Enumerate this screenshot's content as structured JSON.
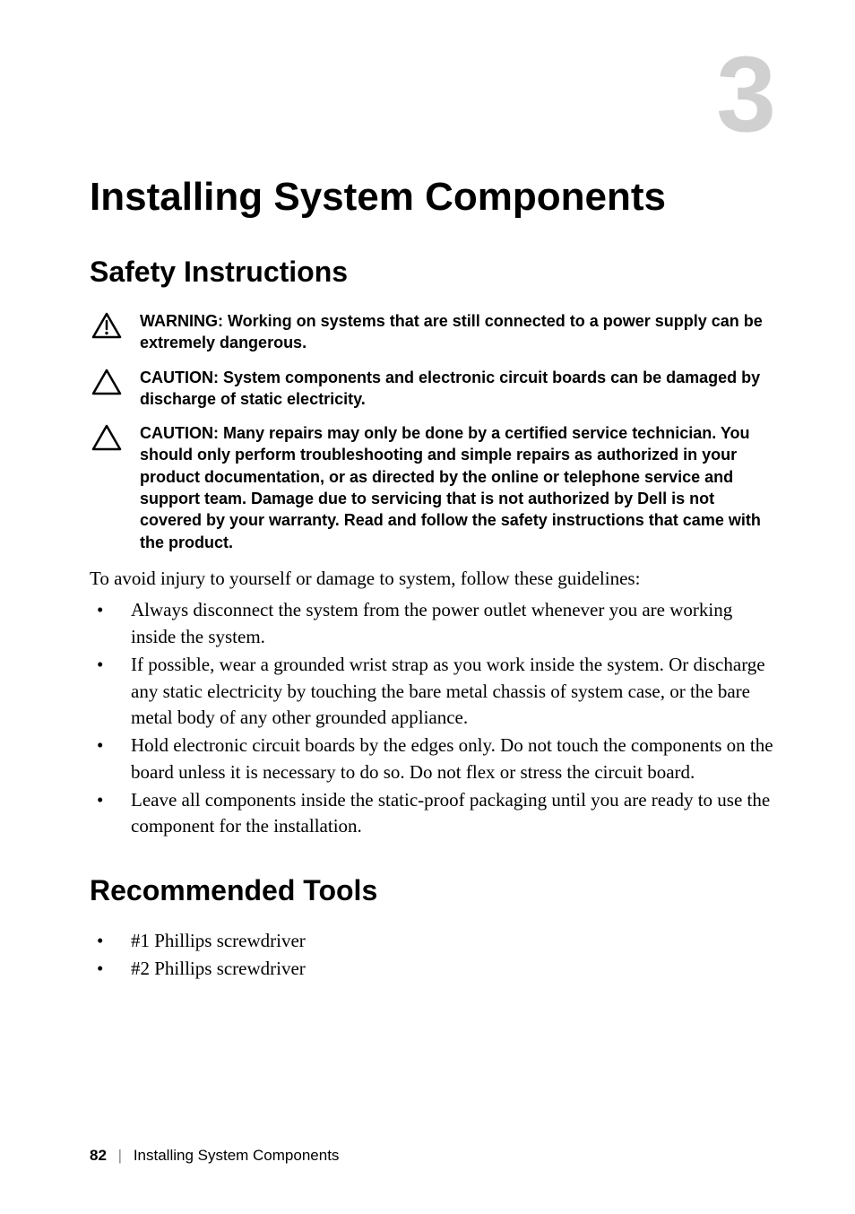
{
  "chapter": {
    "number": "3",
    "title": "Installing System Components"
  },
  "sections": {
    "safety": {
      "title": "Safety Instructions",
      "warning": {
        "label": "WARNING: ",
        "text": "Working on systems that are still connected to a power supply can be extremely dangerous."
      },
      "caution1": {
        "label": "CAUTION: ",
        "text": "System components and electronic circuit boards can be damaged by discharge of static electricity."
      },
      "caution2": {
        "label": "CAUTION: ",
        "text": "Many repairs may only be done by a certified service technician. You should only perform troubleshooting and simple repairs as authorized in your product documentation, or as directed by the online or telephone service and support team. Damage due to servicing that is not authorized by Dell is not covered by your warranty. Read and follow the safety instructions that came with the product."
      },
      "intro": "To avoid injury to yourself or damage to system, follow these guidelines:",
      "guidelines": [
        "Always disconnect the system from the power outlet whenever you are working inside the system.",
        "If possible, wear a grounded wrist strap as you work inside the system. Or discharge any static electricity by touching the bare metal chassis of system case, or the bare metal body of any other grounded appliance.",
        "Hold electronic circuit boards by the edges only. Do not touch the components on the board unless it is necessary to do so. Do not flex or stress the circuit board.",
        "Leave all components inside the static-proof packaging until you are ready to use the component for the installation."
      ]
    },
    "tools": {
      "title": "Recommended Tools",
      "items": [
        "#1 Phillips screwdriver",
        "#2 Phillips screwdriver"
      ]
    }
  },
  "footer": {
    "page": "82",
    "separator": "|",
    "label": "Installing System Components"
  }
}
